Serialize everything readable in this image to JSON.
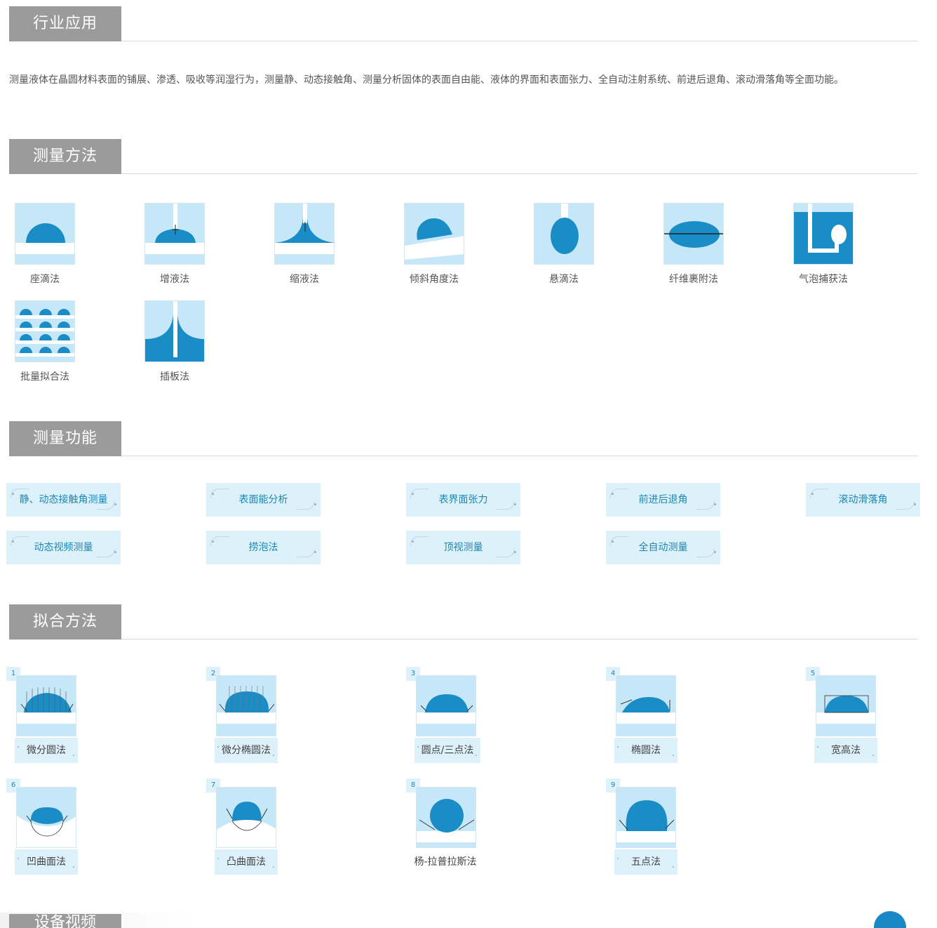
{
  "sections": {
    "industry": "行业应用",
    "methods": "测量方法",
    "functions": "测量功能",
    "fitting": "拟合方法",
    "device": "设备视频"
  },
  "intro": "测量液体在晶圆材料表面的铺展、渗透、吸收等润湿行为，测量静、动态接触角、测量分析固体的表面自由能、液体的界面和表面张力、全自动注射系统、前进后退角、滚动滑落角等全面功能。",
  "methods": [
    {
      "label": "座滴法",
      "icon": "sessile-drop-icon"
    },
    {
      "label": "增液法",
      "icon": "add-liquid-icon"
    },
    {
      "label": "缩液法",
      "icon": "withdraw-liquid-icon"
    },
    {
      "label": "倾斜角度法",
      "icon": "tilt-angle-icon"
    },
    {
      "label": "悬滴法",
      "icon": "pendant-drop-icon"
    },
    {
      "label": "纤维裹附法",
      "icon": "fiber-wrap-icon"
    },
    {
      "label": "气泡捕获法",
      "icon": "captive-bubble-icon"
    },
    {
      "label": "批量拟合法",
      "icon": "batch-fit-icon"
    },
    {
      "label": "插板法",
      "icon": "plate-method-icon"
    }
  ],
  "functions": [
    "静、动态接触角测量",
    "表面能分析",
    "表界面张力",
    "前进后退角",
    "滚动滑落角",
    "动态视频测量",
    "捞泡法",
    "顶视测量",
    "全自动测量"
  ],
  "fitting": [
    {
      "num": "1",
      "label": "微分圆法",
      "icon": "differential-circle-icon"
    },
    {
      "num": "2",
      "label": "微分椭圆法",
      "icon": "differential-ellipse-icon"
    },
    {
      "num": "3",
      "label": "圆点/三点法",
      "icon": "three-point-icon"
    },
    {
      "num": "4",
      "label": "椭圆法",
      "icon": "ellipse-fit-icon"
    },
    {
      "num": "5",
      "label": "宽高法",
      "icon": "width-height-icon"
    },
    {
      "num": "6",
      "label": "凹曲面法",
      "icon": "concave-surface-icon"
    },
    {
      "num": "7",
      "label": "凸曲面法",
      "icon": "convex-surface-icon"
    },
    {
      "num": "8",
      "label": "杨-拉普拉斯法",
      "icon": "young-laplace-icon"
    },
    {
      "num": "9",
      "label": "五点法",
      "icon": "five-point-icon"
    }
  ],
  "colors": {
    "accent": "#1a88c5",
    "drop": "#1b8dc6",
    "panel": "#c6e7f7",
    "tab": "#9b9b9b",
    "chip": "#ddf1fb"
  }
}
